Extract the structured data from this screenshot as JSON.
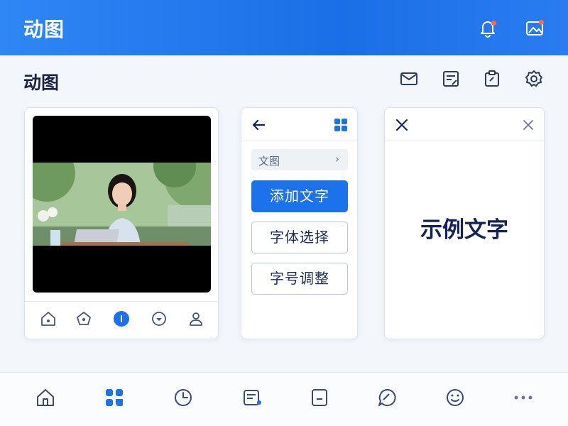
{
  "header": {
    "title": "动图",
    "icons": [
      "bell-icon",
      "image-icon"
    ]
  },
  "subheader": {
    "title": "动图",
    "tools": [
      "mail-icon",
      "edit-note-icon",
      "clipboard-icon",
      "gear-icon"
    ]
  },
  "preview_card": {
    "media": "photo-of-woman-with-laptop",
    "nav_icons": [
      "home-icon",
      "pentagon-icon",
      "info-icon",
      "chevron-down-circle-icon",
      "user-icon"
    ],
    "active_nav": "info-icon"
  },
  "text_panel": {
    "breadcrumb": "文图",
    "add_text": "添加文字",
    "font_select": "字体选择",
    "font_size": "字号调整"
  },
  "preview_panel": {
    "sample_text": "示例文字"
  },
  "bottom_nav": {
    "items": [
      "home-icon",
      "apps-icon",
      "clock-icon",
      "note-icon",
      "document-icon",
      "chat-icon",
      "smile-icon",
      "more-icon"
    ],
    "active": "apps-icon"
  },
  "colors": {
    "accent": "#1b72ea",
    "header": "#2f86f5",
    "badge": "#ff6b3d"
  }
}
